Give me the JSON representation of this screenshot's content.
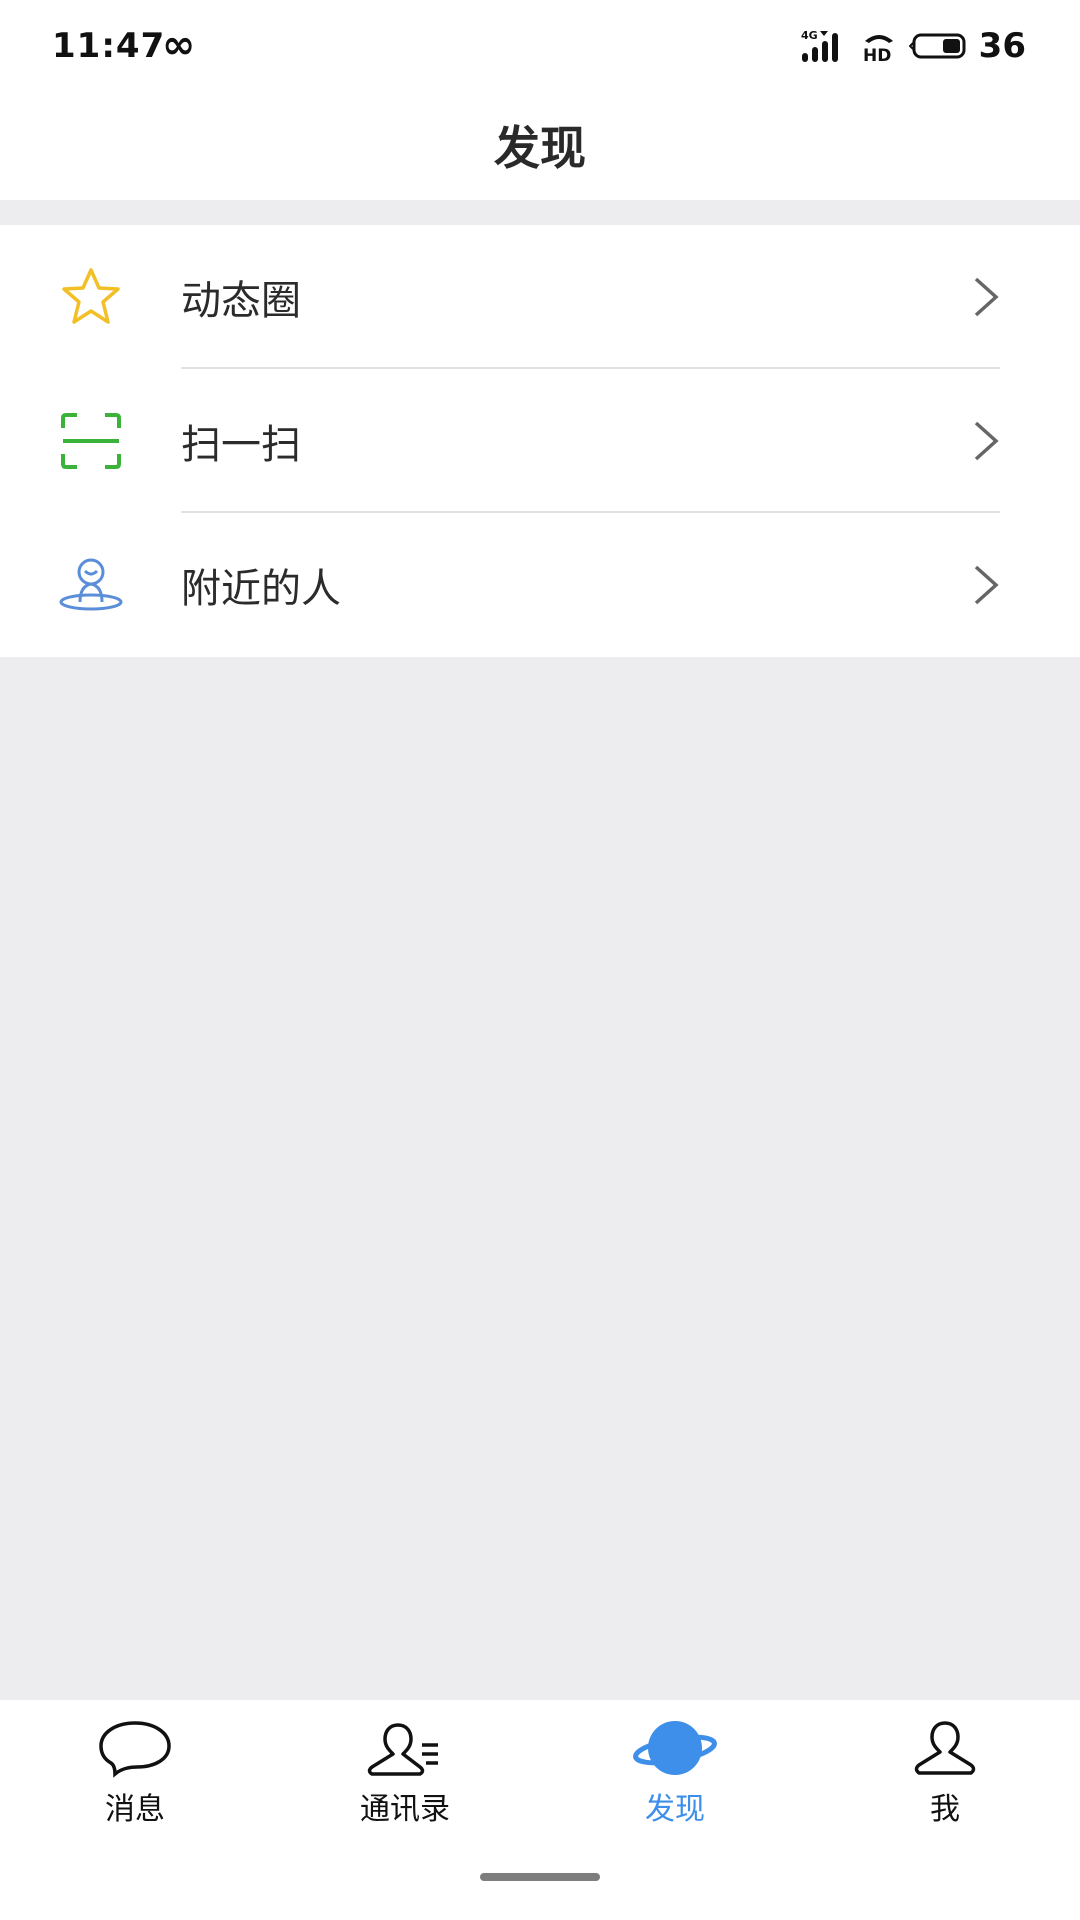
{
  "status_bar": {
    "time": "11:47",
    "infinity_icon": "∞",
    "network": "4G",
    "hd_label": "HD",
    "battery_level": "36"
  },
  "header": {
    "title": "发现"
  },
  "list": {
    "items": [
      {
        "label": "动态圈",
        "icon": "star-icon",
        "icon_color": "#f2c026"
      },
      {
        "label": "扫一扫",
        "icon": "scan-icon",
        "icon_color": "#3bb23a"
      },
      {
        "label": "附近的人",
        "icon": "nearby-person-icon",
        "icon_color": "#5b8ed8"
      }
    ]
  },
  "tabbar": {
    "active_color": "#3d8fe9",
    "tabs": [
      {
        "label": "消息",
        "icon": "chat-bubble-icon",
        "active": false
      },
      {
        "label": "通讯录",
        "icon": "contacts-icon",
        "active": false
      },
      {
        "label": "发现",
        "icon": "planet-icon",
        "active": true
      },
      {
        "label": "我",
        "icon": "person-icon",
        "active": false
      }
    ]
  }
}
